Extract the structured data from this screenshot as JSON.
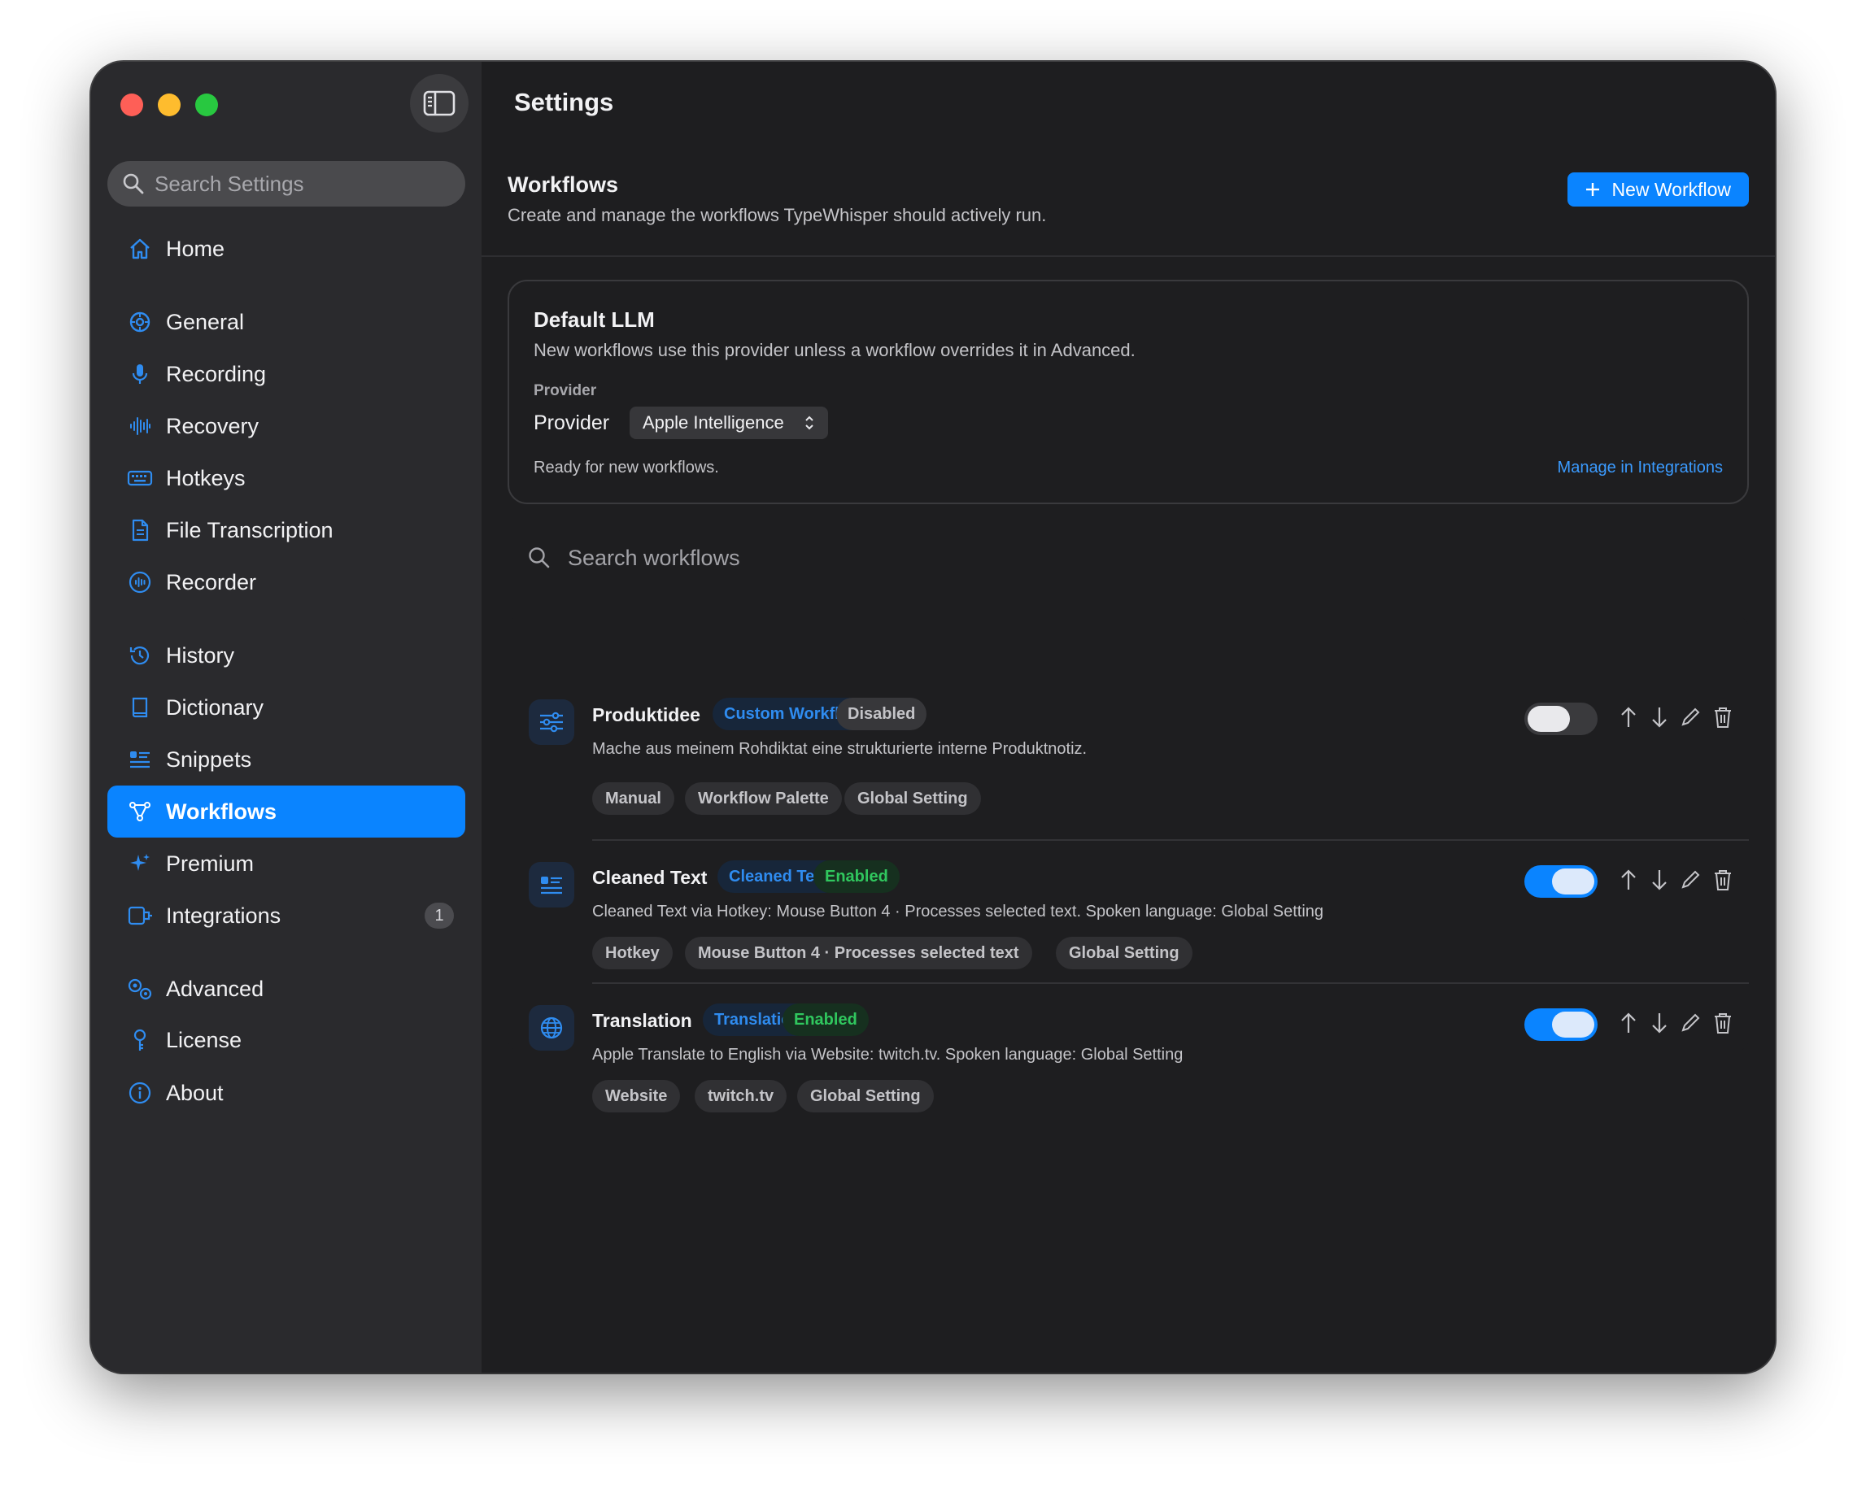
{
  "window": {
    "title": "Settings"
  },
  "sidebar": {
    "search_placeholder": "Search Settings",
    "items": [
      {
        "id": "home",
        "label": "Home",
        "icon": "house-icon"
      },
      {
        "id": "general",
        "label": "General",
        "icon": "gear-icon"
      },
      {
        "id": "recording",
        "label": "Recording",
        "icon": "microphone-icon"
      },
      {
        "id": "recovery",
        "label": "Recovery",
        "icon": "waveform-icon"
      },
      {
        "id": "hotkeys",
        "label": "Hotkeys",
        "icon": "keyboard-icon"
      },
      {
        "id": "file-transcription",
        "label": "File Transcription",
        "icon": "document-icon"
      },
      {
        "id": "recorder",
        "label": "Recorder",
        "icon": "record-circle-icon"
      },
      {
        "id": "history",
        "label": "History",
        "icon": "clock-history-icon"
      },
      {
        "id": "dictionary",
        "label": "Dictionary",
        "icon": "book-icon"
      },
      {
        "id": "snippets",
        "label": "Snippets",
        "icon": "list-check-icon"
      },
      {
        "id": "workflows",
        "label": "Workflows",
        "icon": "workflow-icon",
        "active": true
      },
      {
        "id": "premium",
        "label": "Premium",
        "icon": "sparkles-icon"
      },
      {
        "id": "integrations",
        "label": "Integrations",
        "icon": "plug-icon",
        "badge": "1"
      },
      {
        "id": "advanced",
        "label": "Advanced",
        "icon": "gears-icon"
      },
      {
        "id": "license",
        "label": "License",
        "icon": "key-icon"
      },
      {
        "id": "about",
        "label": "About",
        "icon": "info-icon"
      }
    ]
  },
  "header": {
    "section_title": "Workflows",
    "section_subtitle": "Create and manage the workflows TypeWhisper should actively run.",
    "new_button_label": "New Workflow"
  },
  "default_llm": {
    "title": "Default LLM",
    "subtitle": "New workflows use this provider unless a workflow overrides it in Advanced.",
    "caption": "Provider",
    "provider_label": "Provider",
    "provider_value": "Apple Intelligence",
    "status": "Ready for new workflows.",
    "manage_link": "Manage in Integrations"
  },
  "workflow_search": {
    "placeholder": "Search workflows"
  },
  "workflows": [
    {
      "name": "Produktidee",
      "type_pill": "Custom Workflow",
      "status_pill": "Disabled",
      "enabled": false,
      "description": "Mache aus meinem Rohdiktat eine strukturierte interne Produktnotiz.",
      "tags": [
        "Manual",
        "Workflow Palette",
        "Global Setting"
      ]
    },
    {
      "name": "Cleaned Text",
      "type_pill": "Cleaned Text",
      "status_pill": "Enabled",
      "enabled": true,
      "description": "Cleaned Text via Hotkey: Mouse Button 4 · Processes selected text. Spoken language: Global Setting",
      "tags": [
        "Hotkey",
        "Mouse Button 4 · Processes selected text",
        "Global Setting"
      ]
    },
    {
      "name": "Translation",
      "type_pill": "Translation",
      "status_pill": "Enabled",
      "enabled": true,
      "description": "Apple Translate to English via Website: twitch.tv. Spoken language: Global Setting",
      "tags": [
        "Website",
        "twitch.tv",
        "Global Setting"
      ]
    }
  ],
  "colors": {
    "accent": "#0a84ff",
    "enabled_green": "#30c75e",
    "pill_blue": "#2f8cf0"
  }
}
